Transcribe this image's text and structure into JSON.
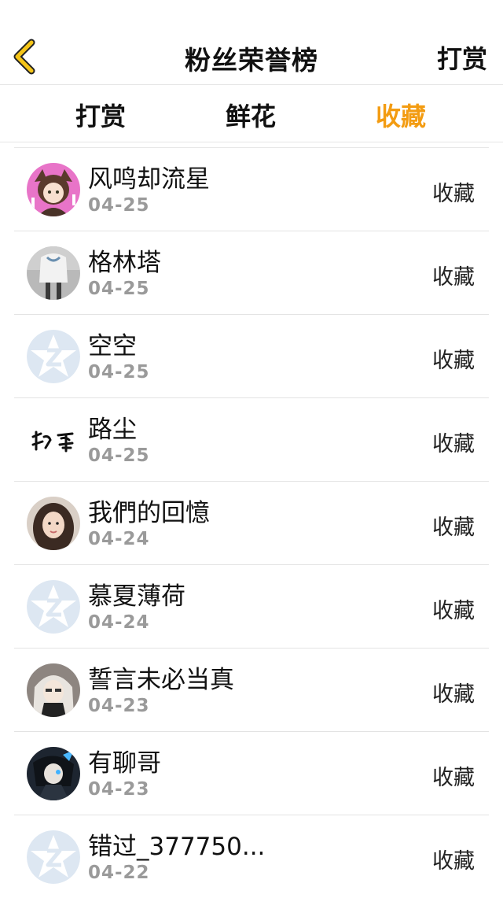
{
  "header": {
    "title": "粉丝荣誉榜",
    "right_action": "打赏",
    "back_icon": "chevron-left-icon",
    "accent_color": "#f39c12"
  },
  "tabs": [
    {
      "label": "打赏",
      "active": false
    },
    {
      "label": "鲜花",
      "active": false
    },
    {
      "label": "收藏",
      "active": true
    }
  ],
  "fans": [
    {
      "name": "风鸣却流星",
      "date": "04-25",
      "type": "收藏",
      "avatar": "anime-girl-pink"
    },
    {
      "name": "格林塔",
      "date": "04-25",
      "type": "收藏",
      "avatar": "photo-girl-white"
    },
    {
      "name": "空空",
      "date": "04-25",
      "type": "收藏",
      "avatar": "default-qq-star"
    },
    {
      "name": "路尘",
      "date": "04-25",
      "type": "收藏",
      "avatar": "calligraphy"
    },
    {
      "name": "我們的回憶",
      "date": "04-24",
      "type": "收藏",
      "avatar": "photo-woman"
    },
    {
      "name": "慕夏薄荷",
      "date": "04-24",
      "type": "收藏",
      "avatar": "default-qq-star"
    },
    {
      "name": "誓言未必当真",
      "date": "04-23",
      "type": "收藏",
      "avatar": "anime-dark"
    },
    {
      "name": "有聊哥",
      "date": "04-23",
      "type": "收藏",
      "avatar": "anime-blue"
    },
    {
      "name": "错过_377750...",
      "date": "04-22",
      "type": "收藏",
      "avatar": "default-qq-star"
    }
  ]
}
